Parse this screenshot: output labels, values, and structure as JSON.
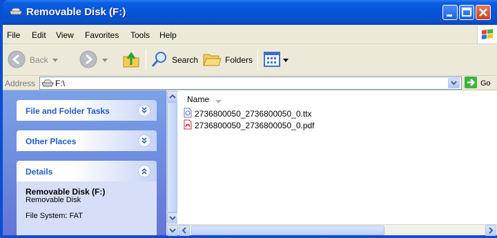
{
  "window": {
    "title": "Removable Disk (F:)",
    "title_icon": "drive-icon"
  },
  "menu": {
    "items": [
      "File",
      "Edit",
      "View",
      "Favorites",
      "Tools",
      "Help"
    ]
  },
  "toolbar": {
    "back_label": "Back",
    "search_label": "Search",
    "folders_label": "Folders"
  },
  "address": {
    "label": "Address",
    "value": "F:\\",
    "go_label": "Go"
  },
  "tasks": {
    "panels": [
      {
        "title": "File and Folder Tasks",
        "expanded": false
      },
      {
        "title": "Other Places",
        "expanded": false
      },
      {
        "title": "Details",
        "expanded": true
      }
    ],
    "details": {
      "name": "Removable Disk (F:)",
      "type": "Removable Disk",
      "filesystem": "File System: FAT"
    }
  },
  "files": {
    "column_name": "Name",
    "items": [
      {
        "name": "2736800050_2736800050_0.ttx",
        "icon": "document-icon"
      },
      {
        "name": "2736800050_2736800050_0.pdf",
        "icon": "pdf-icon"
      }
    ]
  },
  "colors": {
    "title_blue": "#0754d8",
    "taskpane_link": "#215dc6",
    "chrome": "#ece9d8"
  }
}
